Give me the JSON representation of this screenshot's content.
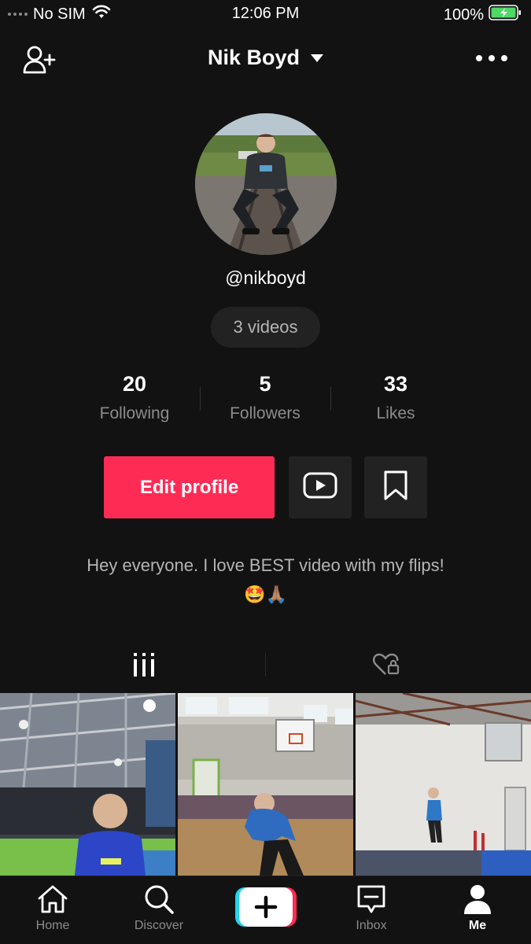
{
  "status_bar": {
    "carrier": "No SIM",
    "time": "12:06 PM",
    "battery": "100%"
  },
  "header": {
    "title": "Nik Boyd",
    "add_friend_icon": "person-plus-icon",
    "menu_icon": "more-dots-icon"
  },
  "profile": {
    "username": "@nikboyd",
    "video_count": "3 videos",
    "stats": [
      {
        "value": "20",
        "label": "Following"
      },
      {
        "value": "5",
        "label": "Followers"
      },
      {
        "value": "33",
        "label": "Likes"
      }
    ],
    "edit_label": "Edit profile",
    "bio": "Hey everyone. I love BEST video with my flips!",
    "bio_emoji": "🤩🙏🏽"
  },
  "tabs": [
    {
      "icon": "grid-icon",
      "active": true
    },
    {
      "icon": "private-liked-icon",
      "active": false
    }
  ],
  "nav": [
    {
      "label": "Home",
      "icon": "home-icon"
    },
    {
      "label": "Discover",
      "icon": "search-icon"
    },
    {
      "label": "",
      "icon": "create-plus-icon"
    },
    {
      "label": "Inbox",
      "icon": "inbox-icon"
    },
    {
      "label": "Me",
      "icon": "person-icon"
    }
  ],
  "colors": {
    "background": "#121212",
    "accent": "#fe2c55",
    "muted_text": "#8c8c8c",
    "surface": "#222222",
    "battery": "#4cd964"
  }
}
